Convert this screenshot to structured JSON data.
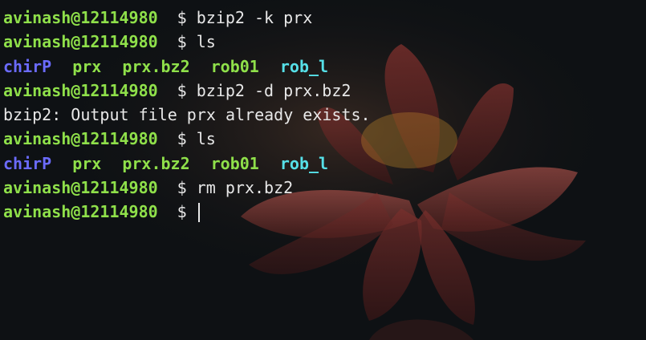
{
  "terminal": {
    "prompt_user": "avinash@12114980",
    "prompt_symbol": "$",
    "lines": [
      {
        "type": "command",
        "text": "bzip2 -k prx"
      },
      {
        "type": "command",
        "text": "ls"
      },
      {
        "type": "listing",
        "items": [
          {
            "name": "chirP",
            "color": "#6b6bff"
          },
          {
            "name": "prx",
            "color": "#8fe04a"
          },
          {
            "name": "prx.bz2",
            "color": "#8fe04a"
          },
          {
            "name": "rob01",
            "color": "#8fe04a"
          },
          {
            "name": "rob_l",
            "color": "#56e0e8"
          }
        ]
      },
      {
        "type": "command",
        "text": "bzip2 -d prx.bz2"
      },
      {
        "type": "output",
        "text": "bzip2: Output file prx already exists."
      },
      {
        "type": "command",
        "text": "ls"
      },
      {
        "type": "listing",
        "items": [
          {
            "name": "chirP",
            "color": "#6b6bff"
          },
          {
            "name": "prx",
            "color": "#8fe04a"
          },
          {
            "name": "prx.bz2",
            "color": "#8fe04a"
          },
          {
            "name": "rob01",
            "color": "#8fe04a"
          },
          {
            "name": "rob_l",
            "color": "#56e0e8"
          }
        ]
      },
      {
        "type": "command",
        "text": "rm prx.bz2"
      },
      {
        "type": "command",
        "text": "",
        "cursor": true
      }
    ]
  },
  "colors": {
    "background": "#0e1114",
    "prompt": "#8fe04a",
    "text": "#e8e8e8",
    "directory": "#6b6bff",
    "executable": "#8fe04a",
    "link": "#56e0e8"
  },
  "background_image": "lotus-flower-wallpaper"
}
